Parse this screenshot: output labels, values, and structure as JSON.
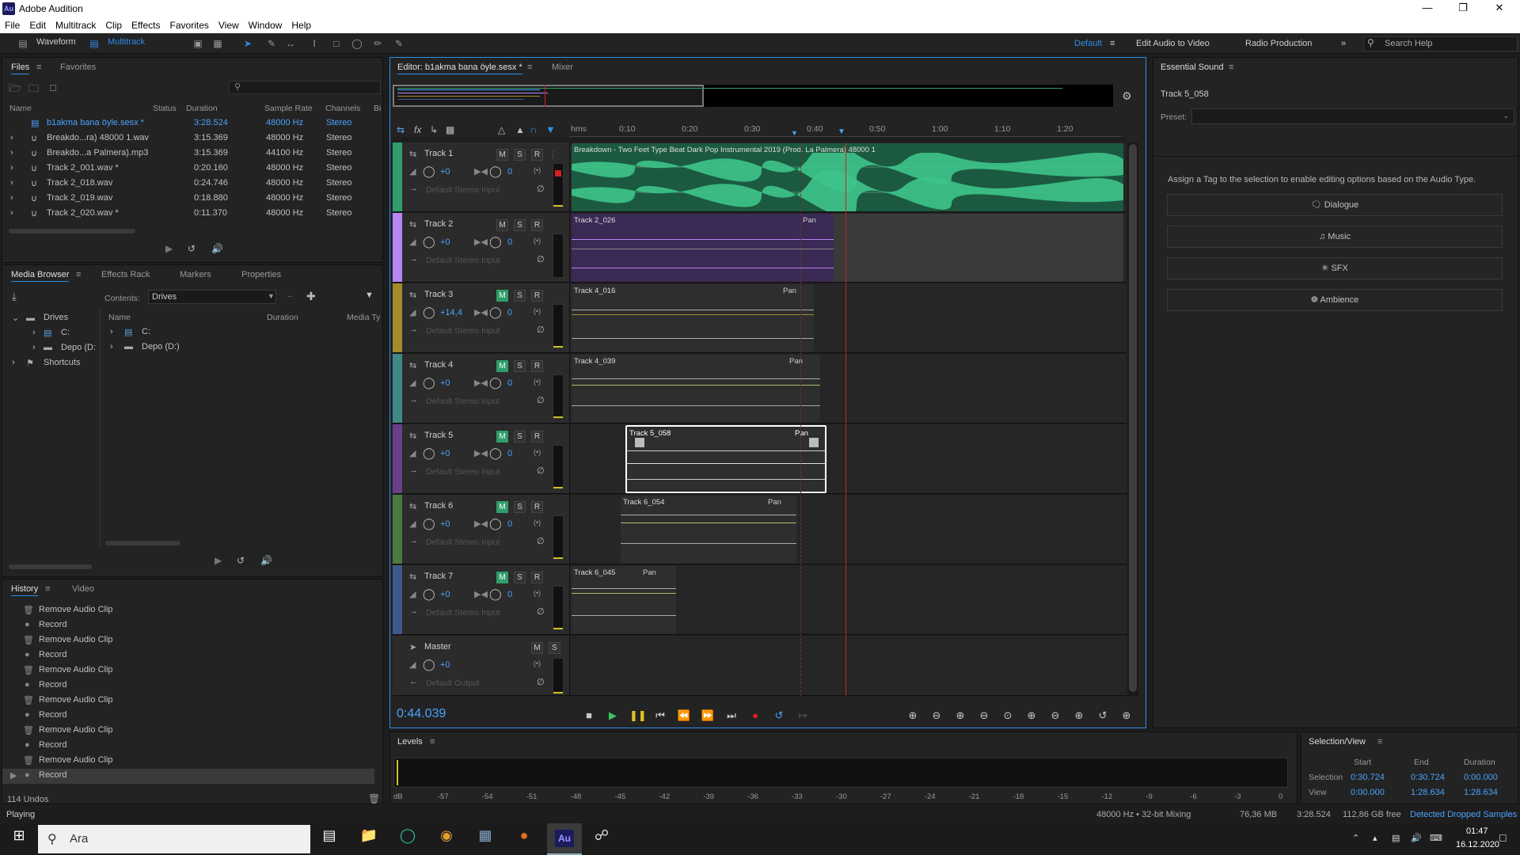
{
  "app": {
    "title": "Adobe Audition",
    "logo": "Au"
  },
  "menu": [
    "File",
    "Edit",
    "Multitrack",
    "Clip",
    "Effects",
    "Favorites",
    "View",
    "Window",
    "Help"
  ],
  "toolbar": {
    "waveform": "Waveform",
    "multitrack": "Multitrack",
    "workspaces": [
      "Default",
      "Edit Audio to Video",
      "Radio Production"
    ],
    "search": "Search Help"
  },
  "files": {
    "tabs": [
      "Files",
      "Favorites"
    ],
    "columns": [
      "Name",
      "Status",
      "Duration",
      "Sample Rate",
      "Channels",
      "Bi"
    ],
    "rows": [
      {
        "name": "b1akma bana öyle.sesx *",
        "duration": "3:28.524",
        "rate": "48000 Hz",
        "ch": "Stereo"
      },
      {
        "name": "Breakdo...ra) 48000 1.wav",
        "duration": "3:15.369",
        "rate": "48000 Hz",
        "ch": "Stereo"
      },
      {
        "name": "Breakdo...a Palmera).mp3",
        "duration": "3:15.369",
        "rate": "44100 Hz",
        "ch": "Stereo"
      },
      {
        "name": "Track 2_001.wav *",
        "duration": "0:20.160",
        "rate": "48000 Hz",
        "ch": "Stereo"
      },
      {
        "name": "Track 2_018.wav",
        "duration": "0:24.746",
        "rate": "48000 Hz",
        "ch": "Stereo"
      },
      {
        "name": "Track 2_019.wav",
        "duration": "0:18.880",
        "rate": "48000 Hz",
        "ch": "Stereo"
      },
      {
        "name": "Track 2_020.wav *",
        "duration": "0:11.370",
        "rate": "48000 Hz",
        "ch": "Stereo"
      }
    ]
  },
  "media": {
    "tabs": [
      "Media Browser",
      "Effects Rack",
      "Markers",
      "Properties"
    ],
    "contents_label": "Contents:",
    "contents_value": "Drives",
    "tree": [
      "Drives",
      "C:",
      "Depo (D:",
      "Shortcuts"
    ],
    "columns": [
      "Name",
      "Duration",
      "Media Ty"
    ],
    "items": [
      "C:",
      "Depo (D:)"
    ]
  },
  "history": {
    "tabs": [
      "History",
      "Video"
    ],
    "items": [
      "Remove Audio Clip",
      "Record",
      "Remove Audio Clip",
      "Record",
      "Remove Audio Clip",
      "Record",
      "Remove Audio Clip",
      "Record",
      "Remove Audio Clip",
      "Record",
      "Remove Audio Clip",
      "Record"
    ],
    "undos": "114 Undos"
  },
  "editor": {
    "tab": "Editor: b1akma bana öyle.sesx *",
    "mixer": "Mixer",
    "ruler": [
      "hms",
      "0:10",
      "0:20",
      "0:30",
      "0:40",
      "0:50",
      "1:00",
      "1:10",
      "1:20"
    ],
    "timecode": "0:44.039",
    "tracks": [
      {
        "name": "Track 1",
        "vol": "+0",
        "pan": "0",
        "input": "Default Stereo Input",
        "color": "#2f9e6a",
        "clip": "Breakdown - Two Feet Type Beat  Dark Pop Instrumental 2019 (Prod. La Palmera) 48000 1"
      },
      {
        "name": "Track 2",
        "vol": "+0",
        "pan": "0",
        "input": "Default Stereo Input",
        "color": "#b985f5",
        "clip": "Track 2_026",
        "pan_label": "Pan"
      },
      {
        "name": "Track 3",
        "vol": "+14,4",
        "pan": "0",
        "input": "Default Stereo Input",
        "color": "#a38a2a",
        "clip": "Track 4_016",
        "pan_label": "Pan"
      },
      {
        "name": "Track 4",
        "vol": "+0",
        "pan": "0",
        "input": "Default Stereo Input",
        "color": "#3f8a86",
        "clip": "Track 4_039",
        "pan_label": "Pan"
      },
      {
        "name": "Track 5",
        "vol": "+0",
        "pan": "0",
        "input": "Default Stereo Input",
        "color": "#6a3f8a",
        "clip": "Track 5_058",
        "pan_label": "Pan"
      },
      {
        "name": "Track 6",
        "vol": "+0",
        "pan": "0",
        "input": "Default Stereo Input",
        "color": "#4a7a3f",
        "clip": "Track 6_054",
        "pan_label": "Pan"
      },
      {
        "name": "Track 7",
        "vol": "+0",
        "pan": "0",
        "input": "Default Stereo Input",
        "color": "#3f5a8a",
        "clip": "Track 6_045",
        "pan_label": "Pan"
      }
    ],
    "master": {
      "name": "Master",
      "vol": "+0",
      "output": "Default Output"
    }
  },
  "essential": {
    "title": "Essential Sound",
    "track": "Track 5_058",
    "preset_label": "Preset:",
    "hint": "Assign a Tag to the selection to enable editing options based on the Audio Type.",
    "buttons": [
      "Dialogue",
      "Music",
      "SFX",
      "Ambience"
    ]
  },
  "levels": {
    "title": "Levels",
    "scale": [
      "dB",
      "-57",
      "-54",
      "-51",
      "-48",
      "-45",
      "-42",
      "-39",
      "-36",
      "-33",
      "-30",
      "-27",
      "-24",
      "-21",
      "-18",
      "-15",
      "-12",
      "-9",
      "-6",
      "-3",
      "0"
    ]
  },
  "selview": {
    "title": "Selection/View",
    "cols": [
      "Start",
      "End",
      "Duration"
    ],
    "selection": [
      "Selection",
      "0:30.724",
      "0:30.724",
      "0:00.000"
    ],
    "view": [
      "View",
      "0:00.000",
      "1:28.634",
      "1:28.634"
    ]
  },
  "status": {
    "left": "Playing",
    "rate": "48000 Hz • 32-bit Mixing",
    "mem": "76,36 MB",
    "dur": "3:28.524",
    "free": "112,86 GB free",
    "warn": "Detected Dropped Samples"
  },
  "taskbar": {
    "search": "Ara",
    "time": "01:47",
    "date": "16.12.2020"
  }
}
